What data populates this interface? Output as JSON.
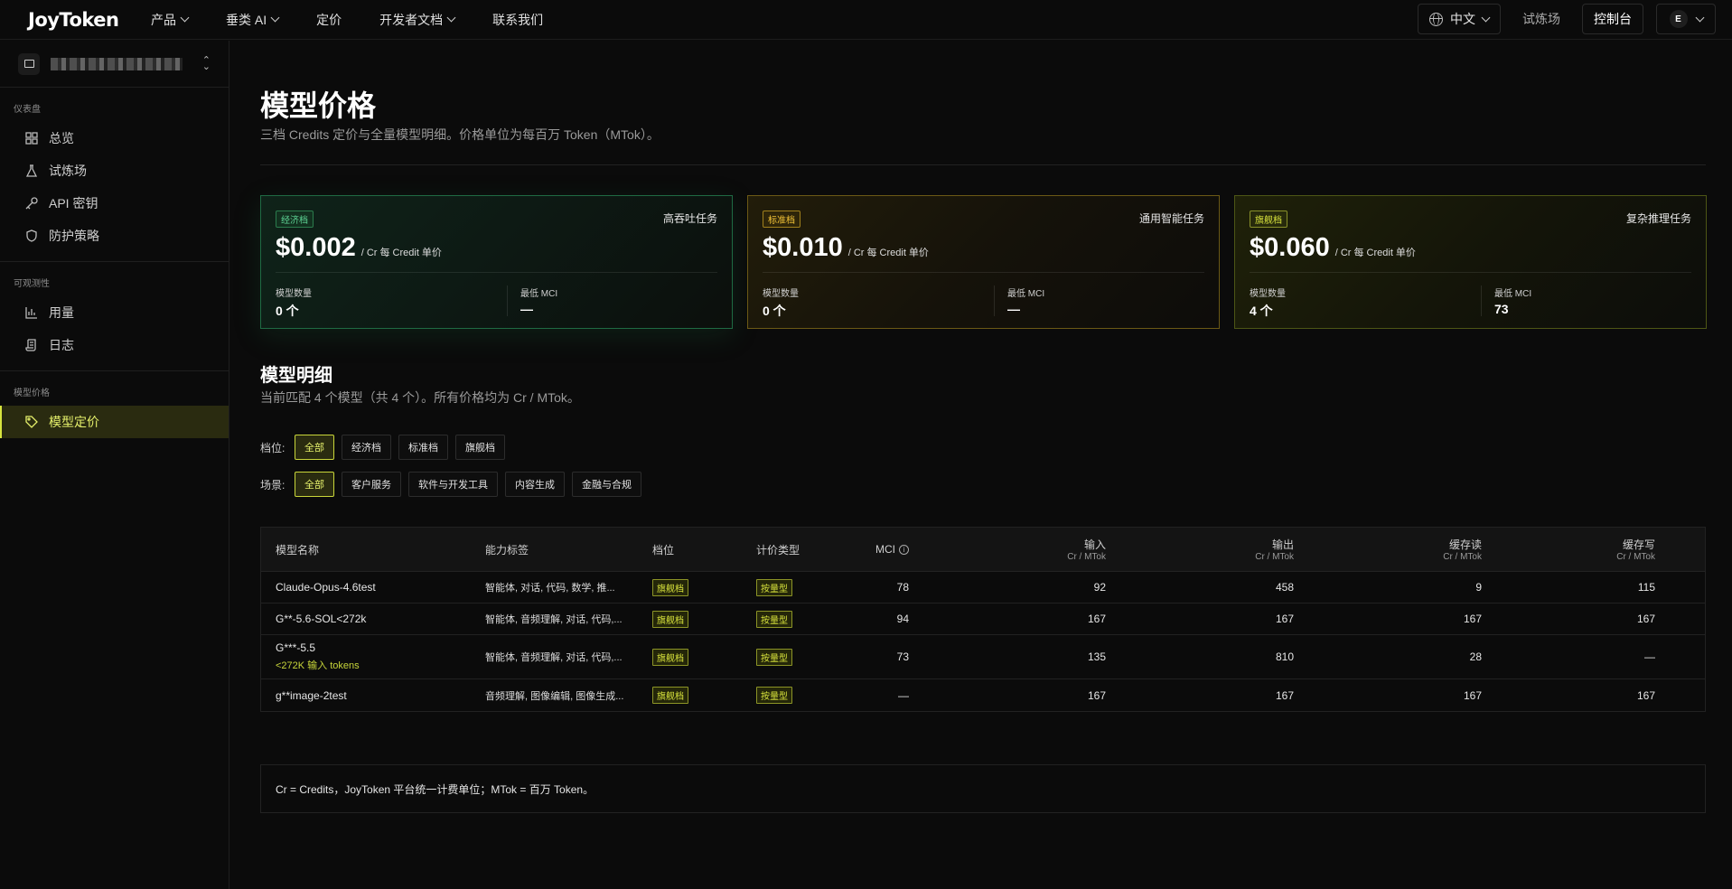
{
  "topbar": {
    "logo": "JoyToken",
    "nav": [
      {
        "label": "产品",
        "dropdown": true
      },
      {
        "label": "垂类 AI",
        "dropdown": true
      },
      {
        "label": "定价",
        "dropdown": false
      },
      {
        "label": "开发者文档",
        "dropdown": true
      },
      {
        "label": "联系我们",
        "dropdown": false
      }
    ],
    "language": "中文",
    "playground": "试炼场",
    "console": "控制台",
    "avatar_initial": "E"
  },
  "sidebar": {
    "sections": [
      {
        "title": "仪表盘",
        "items": [
          {
            "label": "总览",
            "icon": "grid-icon"
          },
          {
            "label": "试炼场",
            "icon": "flask-icon"
          },
          {
            "label": "API 密钥",
            "icon": "key-icon"
          },
          {
            "label": "防护策略",
            "icon": "shield-icon"
          }
        ]
      },
      {
        "title": "可观测性",
        "items": [
          {
            "label": "用量",
            "icon": "bar-chart-icon"
          },
          {
            "label": "日志",
            "icon": "scroll-icon"
          }
        ]
      },
      {
        "title": "模型价格",
        "items": [
          {
            "label": "模型定价",
            "icon": "tag-icon",
            "active": true
          }
        ]
      }
    ]
  },
  "page": {
    "title": "模型价格",
    "subtitle": "三档 Credits 定价与全量模型明细。价格单位为每百万 Token（MTok）。"
  },
  "cards": [
    {
      "tier": "经济档",
      "tag": "高吞吐任务",
      "price": "$0.002",
      "unit": "/ Cr  每 Credit 单价",
      "count_label": "模型数量",
      "count": "0 个",
      "mci_label": "最低 MCI",
      "mci": "—",
      "style": "eco"
    },
    {
      "tier": "标准档",
      "tag": "通用智能任务",
      "price": "$0.010",
      "unit": "/ Cr  每 Credit 单价",
      "count_label": "模型数量",
      "count": "0 个",
      "mci_label": "最低 MCI",
      "mci": "—",
      "style": "std"
    },
    {
      "tier": "旗舰档",
      "tag": "复杂推理任务",
      "price": "$0.060",
      "unit": "/ Cr  每 Credit 单价",
      "count_label": "模型数量",
      "count": "4 个",
      "mci_label": "最低 MCI",
      "mci": "73",
      "style": "flag"
    }
  ],
  "detail": {
    "title": "模型明细",
    "subtitle": "当前匹配 4 个模型（共 4 个）。所有价格均为 Cr / MTok。"
  },
  "filters": {
    "tier_label": "档位:",
    "tiers": [
      {
        "label": "全部",
        "selected": true
      },
      {
        "label": "经济档"
      },
      {
        "label": "标准档"
      },
      {
        "label": "旗舰档"
      }
    ],
    "scene_label": "场景:",
    "scenes": [
      {
        "label": "全部",
        "selected": true
      },
      {
        "label": "客户服务"
      },
      {
        "label": "软件与开发工具"
      },
      {
        "label": "内容生成"
      },
      {
        "label": "金融与合规"
      }
    ]
  },
  "table": {
    "headers": {
      "name": "模型名称",
      "caps": "能力标签",
      "tier": "档位",
      "pricing": "计价类型",
      "mci": "MCI",
      "input": "输入",
      "output": "输出",
      "cache_read": "缓存读",
      "cache_write": "缓存写",
      "unit": "Cr / MTok"
    },
    "rows": [
      {
        "name": "Claude-Opus-4.6test",
        "sub": "",
        "caps": "智能体, 对话, 代码, 数学, 推...",
        "tier": "旗舰档",
        "pricing": "按量型",
        "mci": "78",
        "input": "92",
        "output": "458",
        "cache_read": "9",
        "cache_write": "115"
      },
      {
        "name": "G**-5.6-SOL<272k",
        "sub": "",
        "caps": "智能体, 音频理解, 对话, 代码,...",
        "tier": "旗舰档",
        "pricing": "按量型",
        "mci": "94",
        "input": "167",
        "output": "167",
        "cache_read": "167",
        "cache_write": "167"
      },
      {
        "name": "G***-5.5",
        "sub": "<272K 输入 tokens",
        "caps": "智能体, 音频理解, 对话, 代码,...",
        "tier": "旗舰档",
        "pricing": "按量型",
        "mci": "73",
        "input": "135",
        "output": "810",
        "cache_read": "28",
        "cache_write": "—"
      },
      {
        "name": "g**image-2test",
        "sub": "",
        "caps": "音频理解, 图像编辑, 图像生成...",
        "tier": "旗舰档",
        "pricing": "按量型",
        "mci": "—",
        "input": "167",
        "output": "167",
        "cache_read": "167",
        "cache_write": "167"
      }
    ]
  },
  "note": "Cr = Credits，JoyToken 平台统一计费单位；MTok = 百万 Token。"
}
